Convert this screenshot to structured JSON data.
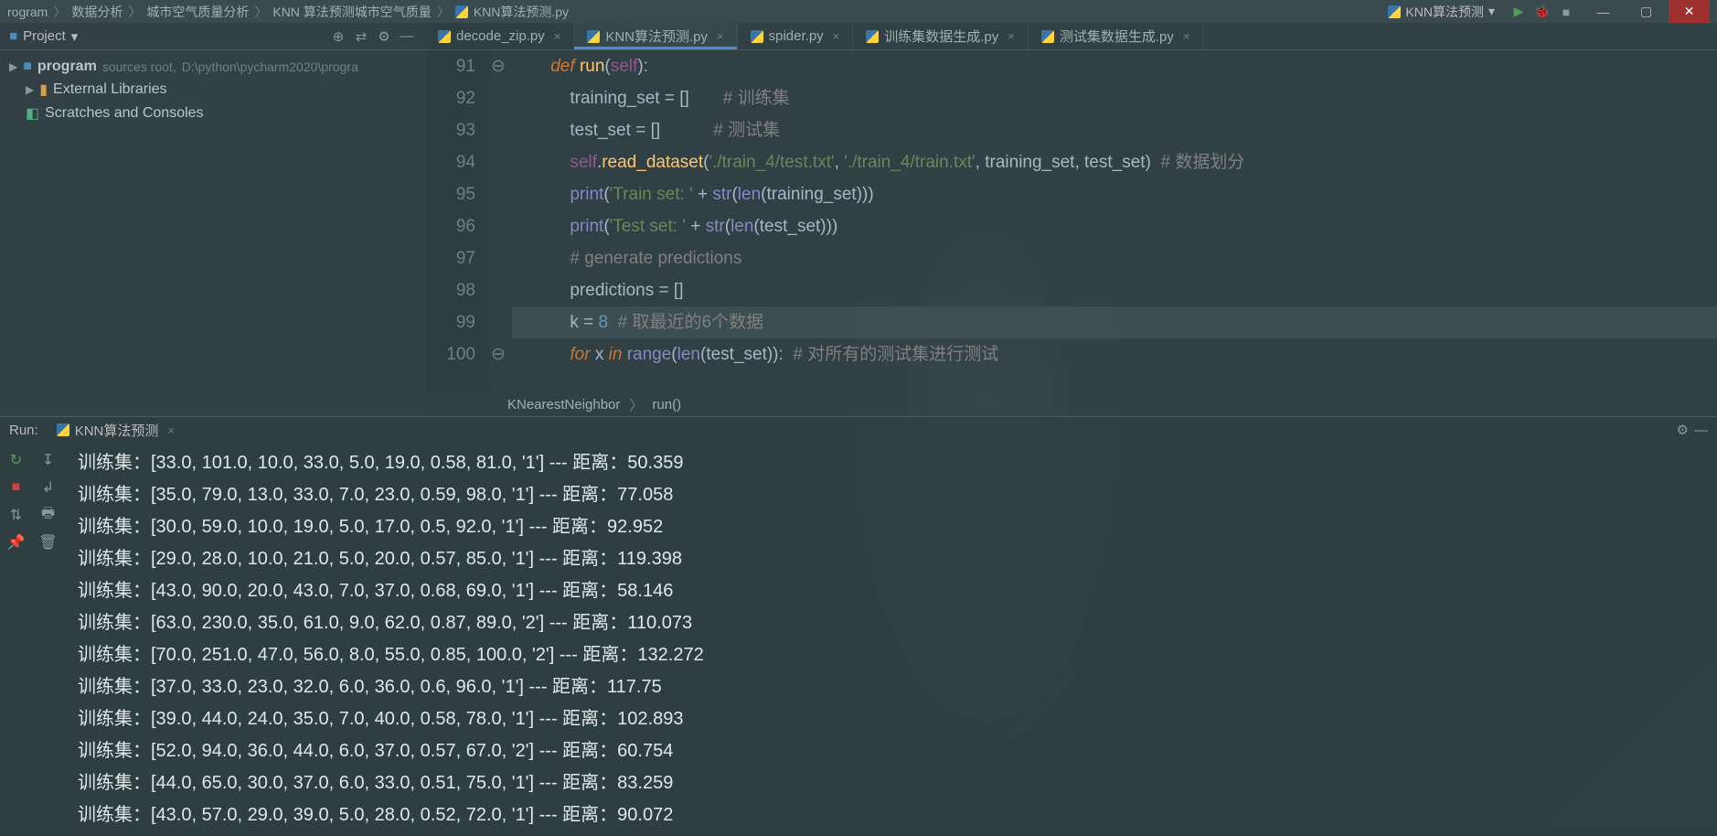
{
  "topbar": {
    "breadcrumb": [
      "rogram",
      "数据分析",
      "城市空气质量分析",
      "KNN 算法预测城市空气质量",
      "KNN算法预测.py"
    ],
    "run_config": "KNN算法预测"
  },
  "project": {
    "title": "Project",
    "root_name": "program",
    "root_role": "sources root,",
    "root_path": "D:\\python\\pycharm2020\\progra",
    "external": "External Libraries",
    "scratches": "Scratches and Consoles"
  },
  "tabs": [
    {
      "label": "decode_zip.py",
      "active": false
    },
    {
      "label": "KNN算法预测.py",
      "active": true
    },
    {
      "label": "spider.py",
      "active": false
    },
    {
      "label": "训练集数据生成.py",
      "active": false
    },
    {
      "label": "测试集数据生成.py",
      "active": false
    }
  ],
  "code": {
    "lines": [
      {
        "n": "91",
        "html": "        <span class='kw'>def</span> <span class='fn'>run</span><span class='op'>(</span><span class='self'>self</span><span class='op'>):</span>"
      },
      {
        "n": "92",
        "html": "            <span class='ident'>training_set</span> <span class='op'>=</span> <span class='op'>[]</span>       <span class='comment'># 训练集</span>"
      },
      {
        "n": "93",
        "html": "            <span class='ident'>test_set</span> <span class='op'>=</span> <span class='op'>[]</span>           <span class='comment'># 测试集</span>"
      },
      {
        "n": "94",
        "html": "            <span class='self'>self</span><span class='op'>.</span><span class='fn'>read_dataset</span><span class='op'>(</span><span class='str'>'./train_4/test.txt'</span><span class='op'>, </span><span class='str'>'./train_4/train.txt'</span><span class='op'>, </span><span class='ident'>training_set</span><span class='op'>, </span><span class='ident'>test_set</span><span class='op'>)</span>  <span class='comment'># 数据划分</span>"
      },
      {
        "n": "95",
        "html": "            <span class='builtin'>print</span><span class='op'>(</span><span class='str'>'Train set: '</span> <span class='op'>+</span> <span class='builtin'>str</span><span class='op'>(</span><span class='builtin'>len</span><span class='op'>(</span><span class='ident'>training_set</span><span class='op'>)))</span>"
      },
      {
        "n": "96",
        "html": "            <span class='builtin'>print</span><span class='op'>(</span><span class='str'>'Test set: '</span> <span class='op'>+</span> <span class='builtin'>str</span><span class='op'>(</span><span class='builtin'>len</span><span class='op'>(</span><span class='ident'>test_set</span><span class='op'>)))</span>"
      },
      {
        "n": "97",
        "html": "            <span class='comment'># generate predictions</span>"
      },
      {
        "n": "98",
        "html": "            <span class='ident'>predictions</span> <span class='op'>=</span> <span class='op'>[]</span>"
      },
      {
        "n": "99",
        "html": "            <span class='ident'>k</span> <span class='op'>=</span> <span class='num'>8</span>  <span class='comment'># 取最近的6个数据</span>",
        "current": true
      },
      {
        "n": "100",
        "html": "            <span class='kw'>for</span> <span class='ident'>x</span> <span class='kw'>in</span> <span class='builtin'>range</span><span class='op'>(</span><span class='builtin'>len</span><span class='op'>(</span><span class='ident'>test_set</span><span class='op'>)):</span>  <span class='comment'># 对所有的测试集进行测试</span>"
      }
    ]
  },
  "breadcrumb_lower": [
    "KNearestNeighbor",
    "run()"
  ],
  "run": {
    "title": "Run:",
    "tab": "KNN算法预测",
    "lines": [
      "训练集：[33.0, 101.0, 10.0, 33.0, 5.0, 19.0, 0.58, 81.0, '1'] --- 距离：50.359",
      "训练集：[35.0, 79.0, 13.0, 33.0, 7.0, 23.0, 0.59, 98.0, '1'] --- 距离：77.058",
      "训练集：[30.0, 59.0, 10.0, 19.0, 5.0, 17.0, 0.5, 92.0, '1'] --- 距离：92.952",
      "训练集：[29.0, 28.0, 10.0, 21.0, 5.0, 20.0, 0.57, 85.0, '1'] --- 距离：119.398",
      "训练集：[43.0, 90.0, 20.0, 43.0, 7.0, 37.0, 0.68, 69.0, '1'] --- 距离：58.146",
      "训练集：[63.0, 230.0, 35.0, 61.0, 9.0, 62.0, 0.87, 89.0, '2'] --- 距离：110.073",
      "训练集：[70.0, 251.0, 47.0, 56.0, 8.0, 55.0, 0.85, 100.0, '2'] --- 距离：132.272",
      "训练集：[37.0, 33.0, 23.0, 32.0, 6.0, 36.0, 0.6, 96.0, '1'] --- 距离：117.75",
      "训练集：[39.0, 44.0, 24.0, 35.0, 7.0, 40.0, 0.58, 78.0, '1'] --- 距离：102.893",
      "训练集：[52.0, 94.0, 36.0, 44.0, 6.0, 37.0, 0.57, 67.0, '2'] --- 距离：60.754",
      "训练集：[44.0, 65.0, 30.0, 37.0, 6.0, 33.0, 0.51, 75.0, '1'] --- 距离：83.259",
      "训练集：[43.0, 57.0, 29.0, 39.0, 5.0, 28.0, 0.52, 72.0, '1'] --- 距离：90.072"
    ]
  }
}
